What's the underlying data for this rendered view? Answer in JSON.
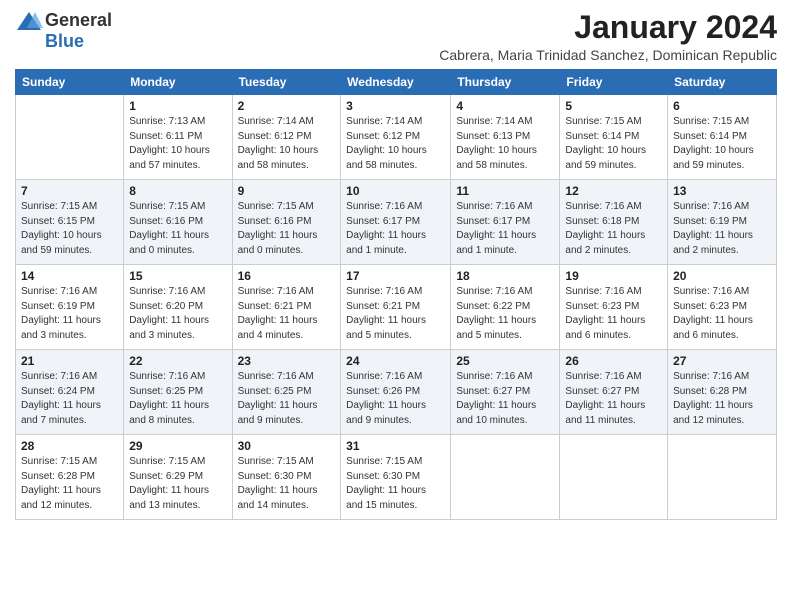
{
  "header": {
    "logo_general": "General",
    "logo_blue": "Blue",
    "month_title": "January 2024",
    "location": "Cabrera, Maria Trinidad Sanchez, Dominican Republic"
  },
  "weekdays": [
    "Sunday",
    "Monday",
    "Tuesday",
    "Wednesday",
    "Thursday",
    "Friday",
    "Saturday"
  ],
  "weeks": [
    [
      {
        "day": "",
        "info": ""
      },
      {
        "day": "1",
        "info": "Sunrise: 7:13 AM\nSunset: 6:11 PM\nDaylight: 10 hours\nand 57 minutes."
      },
      {
        "day": "2",
        "info": "Sunrise: 7:14 AM\nSunset: 6:12 PM\nDaylight: 10 hours\nand 58 minutes."
      },
      {
        "day": "3",
        "info": "Sunrise: 7:14 AM\nSunset: 6:12 PM\nDaylight: 10 hours\nand 58 minutes."
      },
      {
        "day": "4",
        "info": "Sunrise: 7:14 AM\nSunset: 6:13 PM\nDaylight: 10 hours\nand 58 minutes."
      },
      {
        "day": "5",
        "info": "Sunrise: 7:15 AM\nSunset: 6:14 PM\nDaylight: 10 hours\nand 59 minutes."
      },
      {
        "day": "6",
        "info": "Sunrise: 7:15 AM\nSunset: 6:14 PM\nDaylight: 10 hours\nand 59 minutes."
      }
    ],
    [
      {
        "day": "7",
        "info": "Sunrise: 7:15 AM\nSunset: 6:15 PM\nDaylight: 10 hours\nand 59 minutes."
      },
      {
        "day": "8",
        "info": "Sunrise: 7:15 AM\nSunset: 6:16 PM\nDaylight: 11 hours\nand 0 minutes."
      },
      {
        "day": "9",
        "info": "Sunrise: 7:15 AM\nSunset: 6:16 PM\nDaylight: 11 hours\nand 0 minutes."
      },
      {
        "day": "10",
        "info": "Sunrise: 7:16 AM\nSunset: 6:17 PM\nDaylight: 11 hours\nand 1 minute."
      },
      {
        "day": "11",
        "info": "Sunrise: 7:16 AM\nSunset: 6:17 PM\nDaylight: 11 hours\nand 1 minute."
      },
      {
        "day": "12",
        "info": "Sunrise: 7:16 AM\nSunset: 6:18 PM\nDaylight: 11 hours\nand 2 minutes."
      },
      {
        "day": "13",
        "info": "Sunrise: 7:16 AM\nSunset: 6:19 PM\nDaylight: 11 hours\nand 2 minutes."
      }
    ],
    [
      {
        "day": "14",
        "info": "Sunrise: 7:16 AM\nSunset: 6:19 PM\nDaylight: 11 hours\nand 3 minutes."
      },
      {
        "day": "15",
        "info": "Sunrise: 7:16 AM\nSunset: 6:20 PM\nDaylight: 11 hours\nand 3 minutes."
      },
      {
        "day": "16",
        "info": "Sunrise: 7:16 AM\nSunset: 6:21 PM\nDaylight: 11 hours\nand 4 minutes."
      },
      {
        "day": "17",
        "info": "Sunrise: 7:16 AM\nSunset: 6:21 PM\nDaylight: 11 hours\nand 5 minutes."
      },
      {
        "day": "18",
        "info": "Sunrise: 7:16 AM\nSunset: 6:22 PM\nDaylight: 11 hours\nand 5 minutes."
      },
      {
        "day": "19",
        "info": "Sunrise: 7:16 AM\nSunset: 6:23 PM\nDaylight: 11 hours\nand 6 minutes."
      },
      {
        "day": "20",
        "info": "Sunrise: 7:16 AM\nSunset: 6:23 PM\nDaylight: 11 hours\nand 6 minutes."
      }
    ],
    [
      {
        "day": "21",
        "info": "Sunrise: 7:16 AM\nSunset: 6:24 PM\nDaylight: 11 hours\nand 7 minutes."
      },
      {
        "day": "22",
        "info": "Sunrise: 7:16 AM\nSunset: 6:25 PM\nDaylight: 11 hours\nand 8 minutes."
      },
      {
        "day": "23",
        "info": "Sunrise: 7:16 AM\nSunset: 6:25 PM\nDaylight: 11 hours\nand 9 minutes."
      },
      {
        "day": "24",
        "info": "Sunrise: 7:16 AM\nSunset: 6:26 PM\nDaylight: 11 hours\nand 9 minutes."
      },
      {
        "day": "25",
        "info": "Sunrise: 7:16 AM\nSunset: 6:27 PM\nDaylight: 11 hours\nand 10 minutes."
      },
      {
        "day": "26",
        "info": "Sunrise: 7:16 AM\nSunset: 6:27 PM\nDaylight: 11 hours\nand 11 minutes."
      },
      {
        "day": "27",
        "info": "Sunrise: 7:16 AM\nSunset: 6:28 PM\nDaylight: 11 hours\nand 12 minutes."
      }
    ],
    [
      {
        "day": "28",
        "info": "Sunrise: 7:15 AM\nSunset: 6:28 PM\nDaylight: 11 hours\nand 12 minutes."
      },
      {
        "day": "29",
        "info": "Sunrise: 7:15 AM\nSunset: 6:29 PM\nDaylight: 11 hours\nand 13 minutes."
      },
      {
        "day": "30",
        "info": "Sunrise: 7:15 AM\nSunset: 6:30 PM\nDaylight: 11 hours\nand 14 minutes."
      },
      {
        "day": "31",
        "info": "Sunrise: 7:15 AM\nSunset: 6:30 PM\nDaylight: 11 hours\nand 15 minutes."
      },
      {
        "day": "",
        "info": ""
      },
      {
        "day": "",
        "info": ""
      },
      {
        "day": "",
        "info": ""
      }
    ]
  ]
}
